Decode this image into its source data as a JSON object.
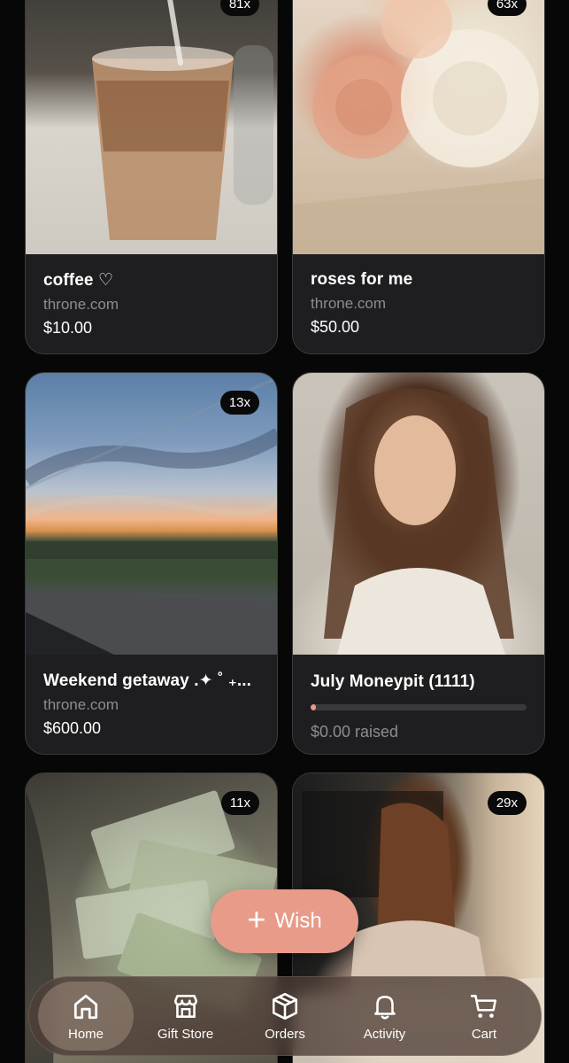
{
  "items": [
    {
      "title": "coffee ♡",
      "site": "throne.com",
      "price": "$10.00",
      "badge": "81x"
    },
    {
      "title": "roses for me",
      "site": "throne.com",
      "price": "$50.00",
      "badge": "63x"
    },
    {
      "title": "Weekend getaway .✦ ˚ ₊...",
      "site": "throne.com",
      "price": "$600.00",
      "badge": "13x"
    },
    {
      "title": "July Moneypit (1111)",
      "raised": "$0.00 raised",
      "progress": 0.02
    },
    {
      "badge": "11x"
    },
    {
      "badge": "29x"
    }
  ],
  "wish_button": {
    "label": "Wish"
  },
  "nav": {
    "items": [
      {
        "label": "Home",
        "icon": "home-icon",
        "active": true
      },
      {
        "label": "Gift Store",
        "icon": "store-icon"
      },
      {
        "label": "Orders",
        "icon": "box-icon"
      },
      {
        "label": "Activity",
        "icon": "bell-icon"
      },
      {
        "label": "Cart",
        "icon": "cart-icon"
      }
    ]
  },
  "colors": {
    "accent": "#e79b88",
    "background": "#070707",
    "card": "#1e1e20",
    "muted_text": "#8d8d91"
  }
}
